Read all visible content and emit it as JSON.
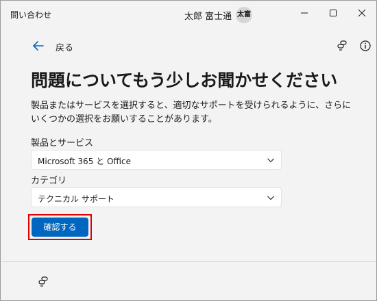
{
  "window": {
    "app_title": "問い合わせ",
    "user_name": "太郎 富士通",
    "avatar_initials": "太富",
    "controls": [
      "minimize-icon",
      "maximize-icon",
      "close-icon"
    ]
  },
  "nav": {
    "back_label": "戻る",
    "back_icon": "arrow-left-icon",
    "share_icon": "share-link-icon",
    "info_icon": "info-icon"
  },
  "main": {
    "title": "問題についてもう少しお聞かせください",
    "description": "製品またはサービスを選択すると、適切なサポートを受けられるように、さらにいくつかの選択をお願いすることがあります。",
    "product_label": "製品とサービス",
    "product_value": "Microsoft 365 と Office",
    "category_label": "カテゴリ",
    "category_value": "テクニカル サポート",
    "confirm_label": "確認する"
  },
  "footer": {
    "icon": "share-link-icon"
  },
  "colors": {
    "accent": "#0067c0",
    "highlight": "#e10000",
    "background": "#f3f3f3"
  }
}
